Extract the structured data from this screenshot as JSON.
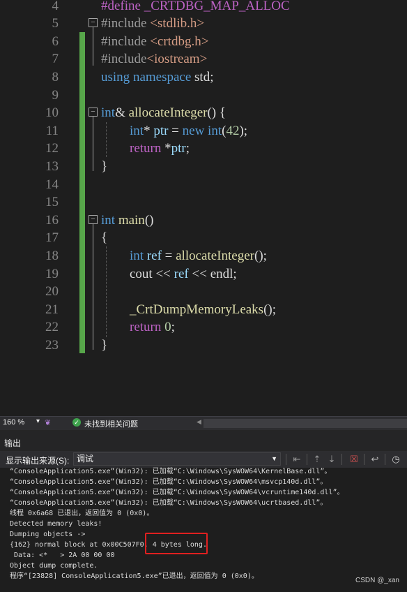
{
  "editor": {
    "line_numbers": [
      "4",
      "5",
      "6",
      "7",
      "8",
      "9",
      "10",
      "11",
      "12",
      "13",
      "14",
      "15",
      "16",
      "17",
      "18",
      "19",
      "20",
      "21",
      "22",
      "23"
    ],
    "code": {
      "l4": [
        "#define",
        " _CRTDBG_MAP_ALLOC"
      ],
      "l5": [
        "#include",
        " <stdlib.h>"
      ],
      "l6": [
        "#include",
        " <crtdbg.h>"
      ],
      "l7": [
        "#include",
        "<iostream>"
      ],
      "l8": [
        "using",
        " ",
        "namespace",
        " std;"
      ],
      "l10": [
        "int",
        "& ",
        "allocateInteger",
        "() {"
      ],
      "l11": [
        "int",
        "* ",
        "ptr",
        " = ",
        "new",
        " ",
        "int",
        "(",
        "42",
        ");"
      ],
      "l12": [
        "return",
        " *",
        "ptr",
        ";"
      ],
      "l13": [
        "}"
      ],
      "l16": [
        "int",
        " ",
        "main",
        "()"
      ],
      "l17": [
        "{"
      ],
      "l18": [
        "int",
        " ",
        "ref",
        " = ",
        "allocateInteger",
        "();"
      ],
      "l19": [
        "cout",
        " << ",
        "ref",
        " << ",
        "endl",
        ";"
      ],
      "l21": [
        "_CrtDumpMemoryLeaks",
        "();"
      ],
      "l22": [
        "return",
        " ",
        "0",
        ";"
      ],
      "l23": [
        "}"
      ]
    }
  },
  "status": {
    "zoom": "160 %",
    "issues": "未找到相关问题"
  },
  "output": {
    "title": "输出",
    "source_label": "显示输出来源(S):",
    "source_value": "调试",
    "lines": [
      "“ConsoleApplication5.exe”(Win32): 已加载“C:\\Windows\\SysWOW64\\KernelBase.dll”。",
      "“ConsoleApplication5.exe”(Win32): 已加载“C:\\Windows\\SysWOW64\\msvcp140d.dll”。",
      "“ConsoleApplication5.exe”(Win32): 已加载“C:\\Windows\\SysWOW64\\vcruntime140d.dll”。",
      "“ConsoleApplication5.exe”(Win32): 已加载“C:\\Windows\\SysWOW64\\ucrtbased.dll”。",
      "线程 0x6a68 已退出，返回值为 0 (0x0)。",
      "Detected memory leaks!",
      "Dumping objects ->",
      "{162} normal block at 0x00C507F0, 4 bytes long.",
      " Data: <*   > 2A 00 00 00",
      "Object dump complete.",
      "程序“[23828] ConsoleApplication5.exe”已退出，返回值为 0 (0x0)。"
    ]
  },
  "watermark": "CSDN @_xan",
  "colors": {
    "keyword": "#569cd6",
    "function": "#dcdcaa",
    "string": "#d69d85",
    "variable": "#9cdcfe",
    "number": "#b5cea8",
    "macro": "#bd63c5",
    "change_bar": "#57a64a",
    "highlight_box": "#e02020"
  }
}
